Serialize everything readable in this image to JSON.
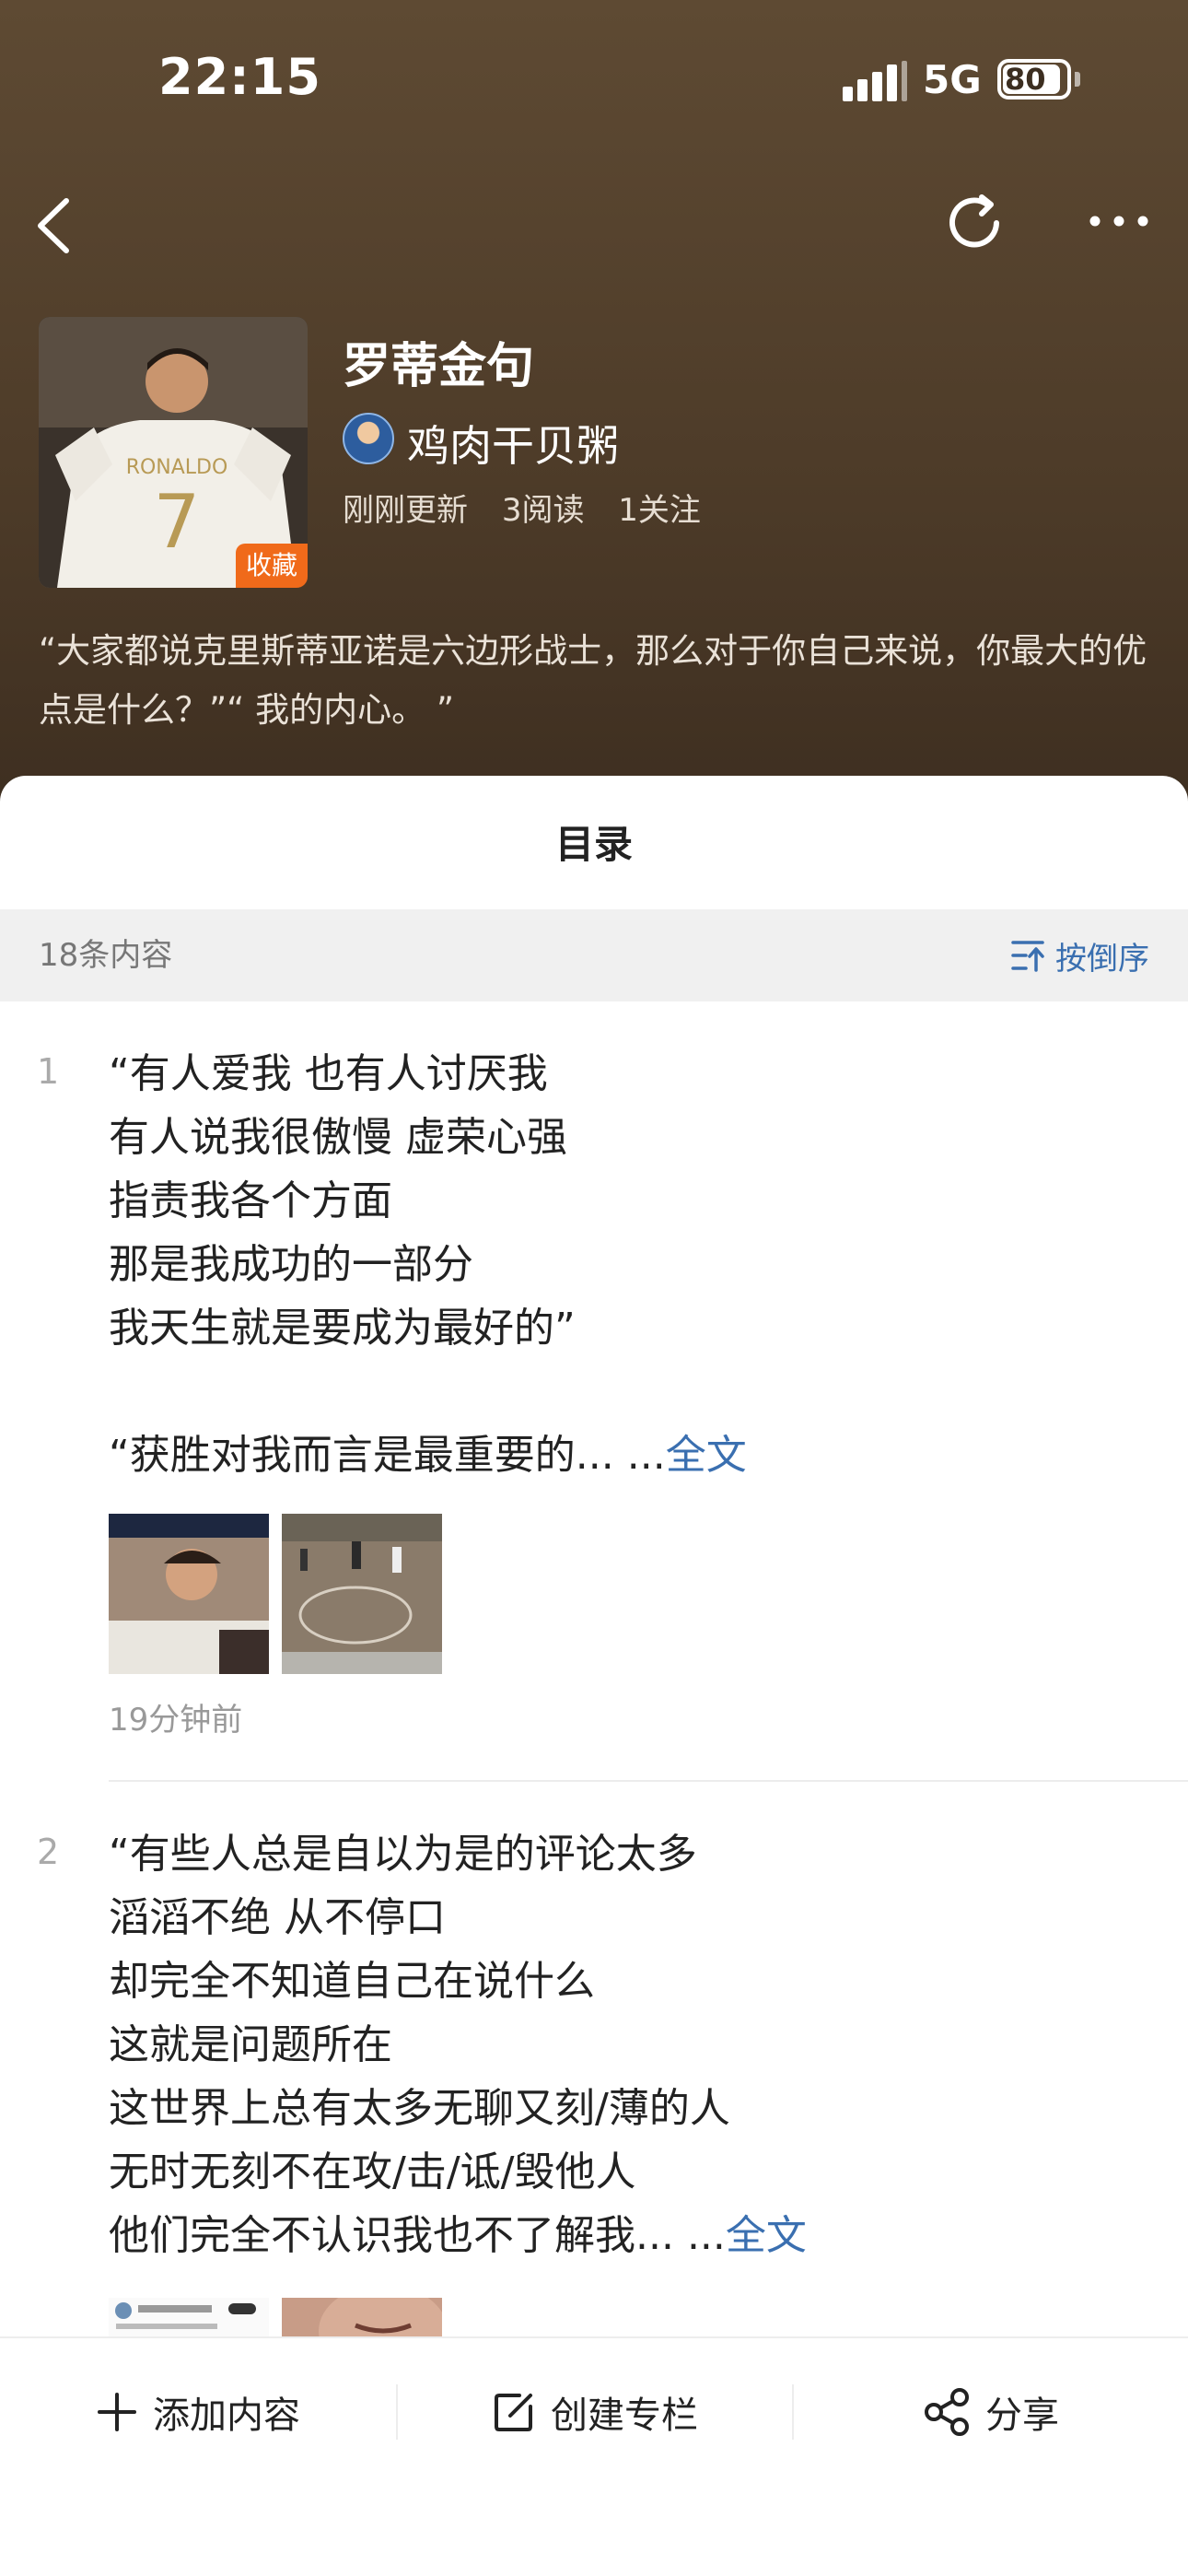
{
  "status_bar": {
    "time": "22:15",
    "network": "5G",
    "battery": "80"
  },
  "nav": {
    "back_icon": "chevron-left-icon",
    "refresh_icon": "refresh-icon",
    "more_icon": "more-horizontal-icon"
  },
  "collection": {
    "title": "罗蒂金句",
    "badge": "收藏",
    "author": "鸡肉干贝粥",
    "updated": "刚刚更新",
    "reads": "3阅读",
    "follows": "1关注",
    "summary": "“大家都说克里斯蒂亚诺是六边形战士，那么对于你自己来说，你最大的优点是什么？”“ 我的内心。 ”"
  },
  "sheet": {
    "title": "目录",
    "count": "18条内容",
    "sort_label": "按倒序"
  },
  "entries": [
    {
      "num": "1",
      "text": "“有人爱我 也有人讨厌我\n有人说我很傲慢 虚荣心强\n指责我各个方面\n那是我成功的一部分\n我天生就是要成为最好的”\n\n“获胜对我而言是最重要的... ...",
      "fulltext": "全文",
      "time": "19分钟前"
    },
    {
      "num": "2",
      "text": "“有些人总是自以为是的评论太多\n滔滔不绝 从不停口\n却完全不知道自己在说什么\n这就是问题所在\n这世界上总有太多无聊又刻/薄的人\n无时无刻不在攻/击/诋/毁他人\n他们完全不认识我也不了解我... ...",
      "fulltext": "全文"
    }
  ],
  "bottom_bar": {
    "add": "添加内容",
    "create": "创建专栏",
    "share": "分享"
  },
  "colors": {
    "header_brown": "#5e4a33",
    "link_blue": "#3a6fb0",
    "badge_orange": "#f06a1a"
  }
}
